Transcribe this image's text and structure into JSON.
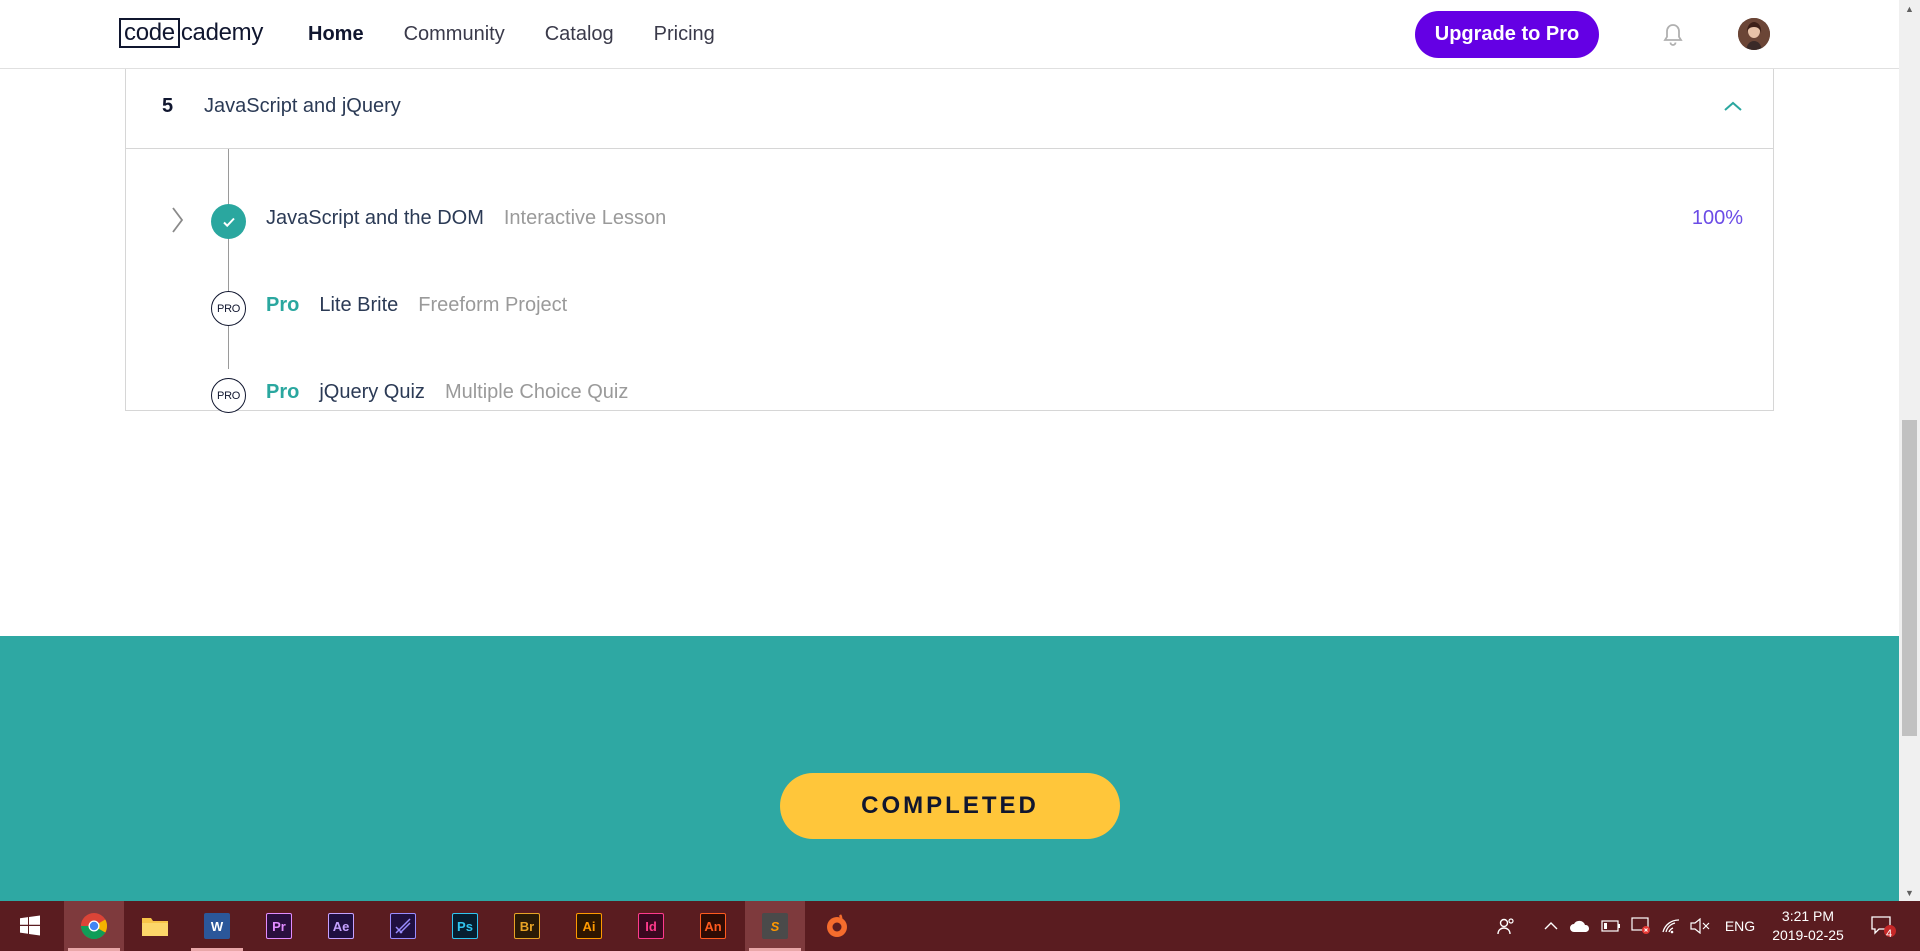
{
  "header": {
    "logo_boxed": "code",
    "logo_rest": "cademy",
    "nav": [
      "Home",
      "Community",
      "Catalog",
      "Pricing"
    ],
    "upgrade_label": "Upgrade to Pro"
  },
  "module": {
    "number": "5",
    "title": "JavaScript and jQuery",
    "items": [
      {
        "title": "JavaScript and the DOM",
        "type": "Interactive Lesson",
        "progress": "100%",
        "completed": true
      },
      {
        "pro_label": "Pro",
        "badge": "PRO",
        "title": "Lite Brite",
        "type": "Freeform Project"
      },
      {
        "pro_label": "Pro",
        "badge": "PRO",
        "title": "jQuery Quiz",
        "type": "Multiple Choice Quiz"
      }
    ]
  },
  "cta": {
    "label": "COMPLETED"
  },
  "taskbar": {
    "apps": [
      {
        "name": "windows-start-icon"
      },
      {
        "name": "chrome-icon",
        "active": true
      },
      {
        "name": "file-explorer-icon"
      },
      {
        "name": "word-icon",
        "label": "W",
        "bg": "#2b579a",
        "fg": "#ffffff"
      },
      {
        "name": "premiere-icon",
        "label": "Pr",
        "bg": "#2a0f3e",
        "fg": "#e28cff"
      },
      {
        "name": "after-effects-icon",
        "label": "Ae",
        "bg": "#1f0f40",
        "fg": "#c5a1ff"
      },
      {
        "name": "media-encoder-icon",
        "label": "",
        "bg": "#1f0f40",
        "fg": "#9a8cff"
      },
      {
        "name": "photoshop-icon",
        "label": "Ps",
        "bg": "#061e30",
        "fg": "#31c5f0"
      },
      {
        "name": "bridge-icon",
        "label": "Br",
        "bg": "#2a1a06",
        "fg": "#e8a325"
      },
      {
        "name": "illustrator-icon",
        "label": "Ai",
        "bg": "#2e1600",
        "fg": "#ff9a00"
      },
      {
        "name": "indesign-icon",
        "label": "Id",
        "bg": "#3a0820",
        "fg": "#ff3a8c"
      },
      {
        "name": "animate-icon",
        "label": "An",
        "bg": "#2e0b04",
        "fg": "#ff5a1f"
      },
      {
        "name": "sublime-text-icon",
        "label": "S",
        "bg": "#4a4a4a",
        "fg": "#ff9800",
        "active": true
      },
      {
        "name": "origin-icon"
      }
    ],
    "language": "ENG",
    "time": "3:21 PM",
    "date": "2019-02-25",
    "notifications": "4"
  },
  "colors": {
    "brand_purple": "#6400e4",
    "teal": "#2ea8a3",
    "completed_yellow": "#ffc63a",
    "check_teal": "#2aa79f",
    "progress_purple": "#6b4ce6"
  }
}
